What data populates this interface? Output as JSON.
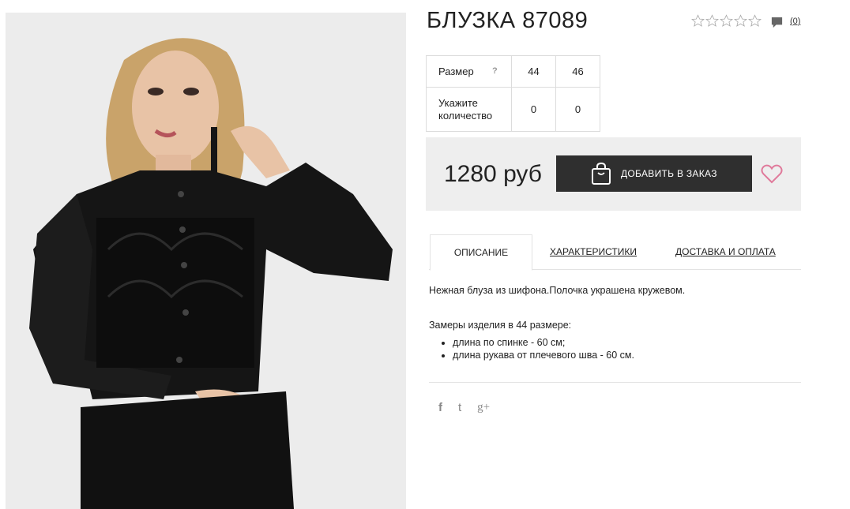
{
  "product": {
    "title": "БЛУЗКА 87089",
    "rating_stars": 0,
    "rating_max": 5,
    "review_count": "(0)",
    "image_alt": "product-photo"
  },
  "sizes": {
    "label": "Размер",
    "help": "?",
    "values": [
      "44",
      "46"
    ],
    "qty_label": "Укажите количество",
    "quantities": [
      "0",
      "0"
    ]
  },
  "buy": {
    "price": "1280 руб",
    "add_label": "ДОБАВИТЬ В ЗАКАЗ",
    "accent": "#e07a9b"
  },
  "tabs": [
    {
      "label": "ОПИСАНИЕ",
      "active": true
    },
    {
      "label": "ХАРАКТЕРИСТИКИ",
      "active": false
    },
    {
      "label": "ДОСТАВКА И ОПЛАТА",
      "active": false
    }
  ],
  "description": {
    "text": "Нежная блуза из шифона.Полочка украшена кружевом.",
    "measure_title": "Замеры изделия в 44 размере:",
    "items": [
      "длина по спинке - 60 см;",
      "длина рукава от плечевого шва - 60 см."
    ]
  },
  "social": [
    "f",
    "t",
    "g+"
  ]
}
